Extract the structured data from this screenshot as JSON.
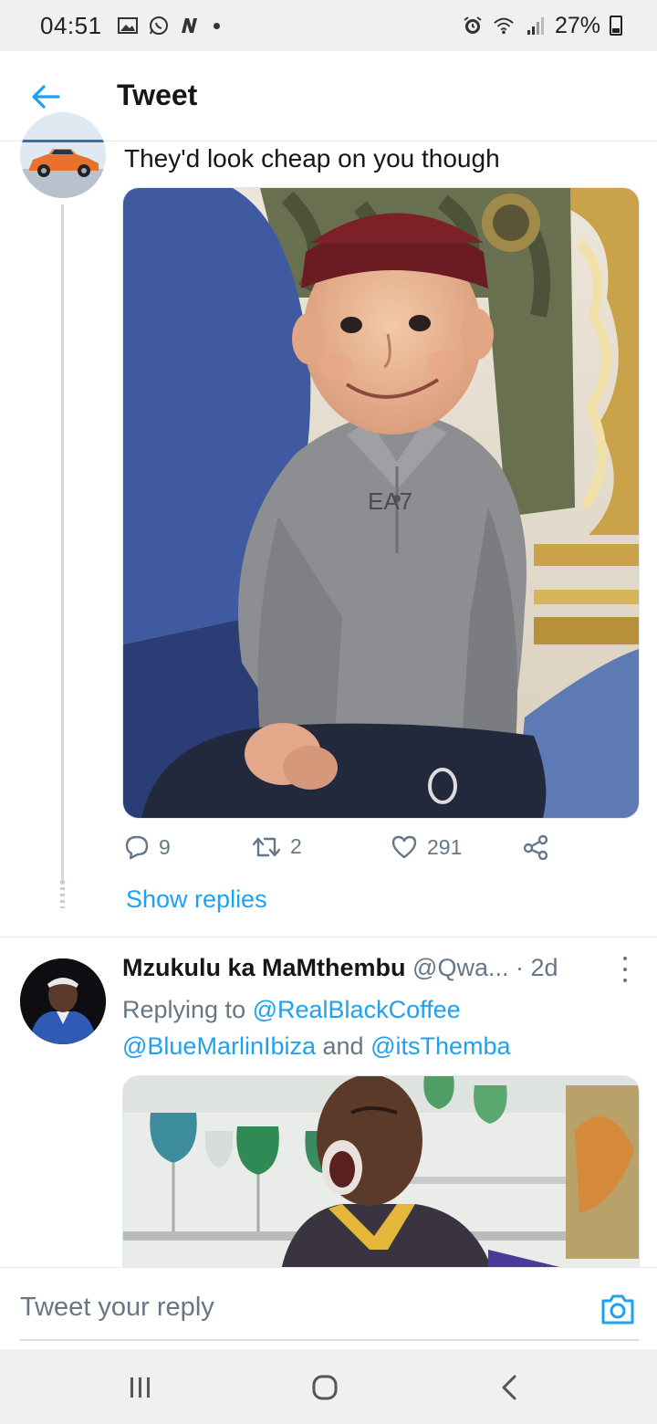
{
  "status_bar": {
    "time": "04:51",
    "battery": "27%",
    "left_icons": [
      "gallery-icon",
      "whatsapp-icon",
      "news-icon"
    ],
    "right_icons": [
      "alarm-icon",
      "wifi-icon",
      "signal-icon",
      "battery-icon"
    ]
  },
  "header": {
    "title": "Tweet",
    "back_icon": "arrow-left-icon"
  },
  "tweet1": {
    "text": "They'd look cheap on you though",
    "image_alt": "Boy in grey EA7 polo shirt and maroon cap smiling",
    "shirt_logo": "EA7",
    "replies": "9",
    "retweets": "2",
    "likes": "291",
    "show_replies": "Show replies"
  },
  "tweet2": {
    "name": "Mzukulu ka MaMthembu",
    "handle": "@Qwa...",
    "time": "· 2d",
    "replying_prefix": "Replying to",
    "mention1": "@RealBlackCoffee",
    "mention2": "@BlueMarlinIbiza",
    "and_text": "and",
    "mention3": "@itsThemba",
    "image_alt": "Man with shocked open-mouth expression"
  },
  "reply": {
    "placeholder": "Tweet your reply"
  },
  "colors": {
    "accent": "#1da1f2",
    "text": "#14171a",
    "secondary": "#657786"
  }
}
